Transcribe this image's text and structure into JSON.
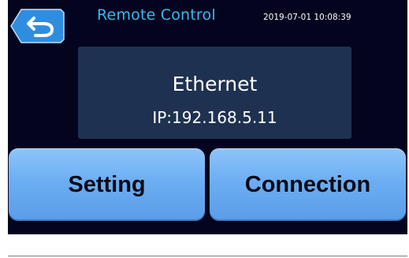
{
  "header": {
    "title": "Remote Control",
    "datetime": "2019-07-01 10:08:39",
    "back_icon": "back-arrow-icon"
  },
  "connection": {
    "type": "Ethernet",
    "ip": "IP:192.168.5.11"
  },
  "buttons": {
    "setting_label": "Setting",
    "connection_label": "Connection"
  },
  "colors": {
    "background": "#04041e",
    "title": "#3cb9f0",
    "panel": "#1e3150",
    "button": "#6caef3",
    "back_button": "#2f8de0"
  }
}
